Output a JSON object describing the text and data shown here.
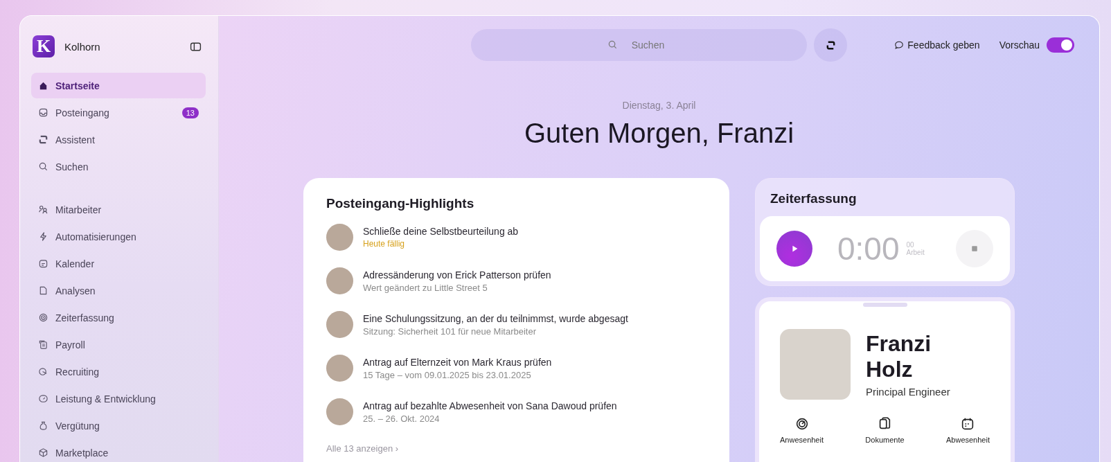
{
  "sidebar": {
    "brand": {
      "logo_letter": "K",
      "name": "Kolhorn"
    },
    "sections": [
      {
        "items": [
          {
            "label": "Startseite",
            "selected": true
          },
          {
            "label": "Posteingang",
            "selected": false,
            "badge": "13"
          },
          {
            "label": "Assistent",
            "selected": false
          },
          {
            "label": "Suchen",
            "selected": false
          }
        ]
      },
      {
        "items": [
          {
            "label": "Mitarbeiter",
            "selected": false
          },
          {
            "label": "Automatisierungen",
            "selected": false
          },
          {
            "label": "Kalender",
            "selected": false
          },
          {
            "label": "Analysen",
            "selected": false
          },
          {
            "label": "Zeiterfassung",
            "selected": false
          },
          {
            "label": "Payroll",
            "selected": false
          },
          {
            "label": "Recruiting",
            "selected": false
          },
          {
            "label": "Leistung & Entwicklung",
            "selected": false
          },
          {
            "label": "Vergütung",
            "selected": false
          },
          {
            "label": "Marketplace",
            "selected": false
          }
        ]
      }
    ]
  },
  "topbar": {
    "search": {
      "placeholder": "Suchen"
    },
    "feedback": "Feedback geben",
    "preview": {
      "label": "Vorschau",
      "on": true
    }
  },
  "greeting": {
    "date": "Dienstag, 3. April",
    "title": "Guten Morgen, Franzi"
  },
  "inbox": {
    "title": "Posteingang-Highlights",
    "items": [
      {
        "title": "Schließe deine Selbstbeurteilung ab",
        "subtitle": "Heute fällig",
        "kind": "due"
      },
      {
        "title": "Adressänderung von Erick Patterson prüfen",
        "subtitle": "Wert geändert zu Little Street 5",
        "kind": "detail"
      },
      {
        "title": "Eine Schulungssitzung, an der du teilnimmst, wurde abgesagt",
        "subtitle": "Sitzung: Sicherheit 101 für neue Mitarbeiter",
        "kind": "detail"
      },
      {
        "title": "Antrag auf Elternzeit von Mark Kraus prüfen",
        "subtitle": "15 Tage – vom 09.01.2025 bis 23.01.2025",
        "kind": "detail"
      },
      {
        "title": "Antrag auf bezahlte Abwesenheit von Sana Dawoud prüfen",
        "subtitle": "25. – 26. Okt. 2024",
        "kind": "detail"
      }
    ],
    "show_all": "Alle 13 anzeigen",
    "show_all_arrow": "›"
  },
  "time_tracking": {
    "title": "Zeiterfassung",
    "time": "0:00",
    "seconds": "00",
    "label": "Arbeit"
  },
  "profile": {
    "name": "Franzi Holz",
    "role": "Principal Engineer",
    "actions": [
      {
        "label": "Anwesenheit"
      },
      {
        "label": "Dokumente"
      },
      {
        "label": "Abwesenheit"
      }
    ]
  }
}
